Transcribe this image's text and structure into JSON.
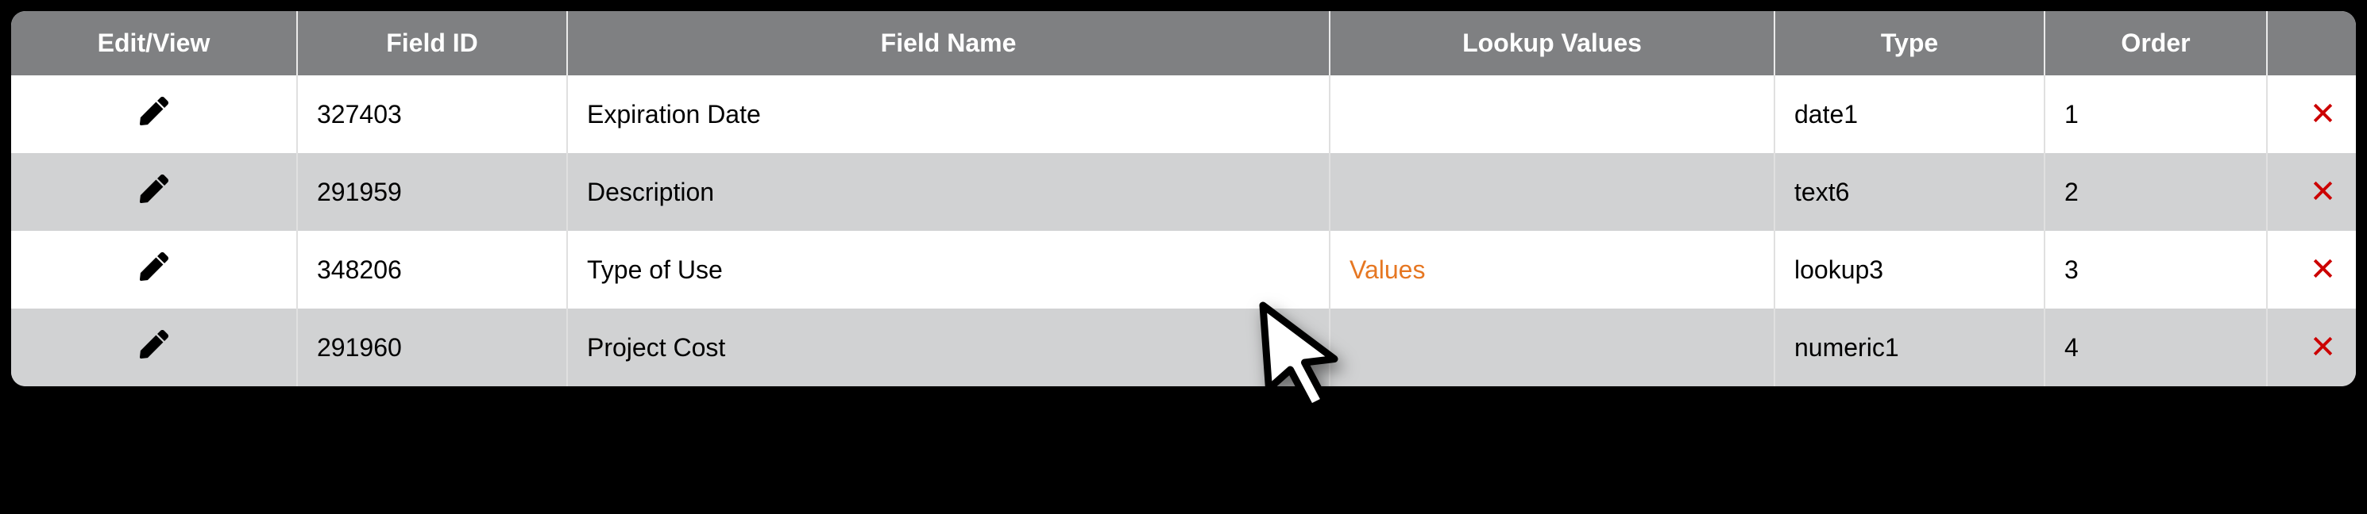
{
  "headers": {
    "edit": "Edit/View",
    "field_id": "Field ID",
    "field_name": "Field Name",
    "lookup": "Lookup Values",
    "type": "Type",
    "order": "Order",
    "delete": ""
  },
  "lookup_link_label": "Values",
  "rows": [
    {
      "field_id": "327403",
      "field_name": "Expiration Date",
      "has_lookup": false,
      "type": "date1",
      "order": "1"
    },
    {
      "field_id": "291959",
      "field_name": "Description",
      "has_lookup": false,
      "type": "text6",
      "order": "2"
    },
    {
      "field_id": "348206",
      "field_name": "Type of Use",
      "has_lookup": true,
      "type": "lookup3",
      "order": "3"
    },
    {
      "field_id": "291960",
      "field_name": "Project Cost",
      "has_lookup": false,
      "type": "numeric1",
      "order": "4"
    }
  ]
}
